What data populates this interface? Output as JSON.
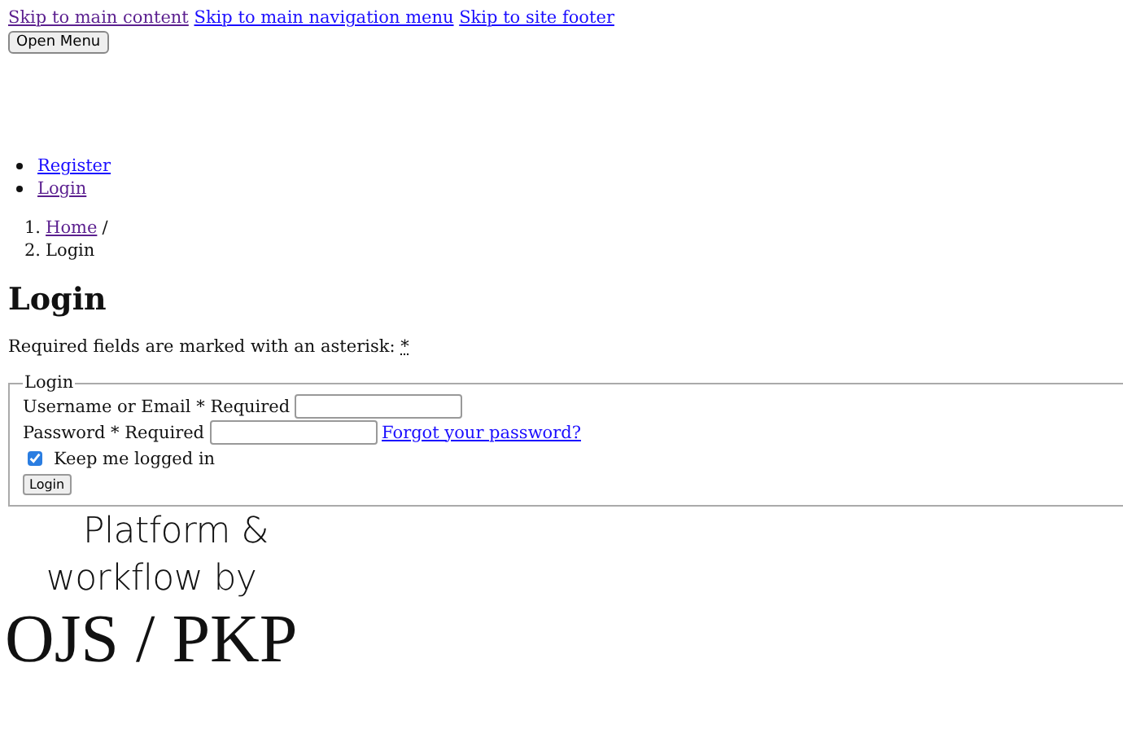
{
  "skip_links": [
    {
      "label": "Skip to main content",
      "visited": true
    },
    {
      "label": "Skip to main navigation menu",
      "visited": false
    },
    {
      "label": "Skip to site footer",
      "visited": false
    }
  ],
  "menu_button": "Open Menu",
  "user_nav": [
    {
      "label": "Register",
      "visited": false
    },
    {
      "label": "Login",
      "visited": true
    }
  ],
  "breadcrumb": [
    {
      "marker": "1.",
      "label": "Home",
      "separator": "/",
      "kind": "link"
    },
    {
      "marker": "2.",
      "label": "Login",
      "kind": "current"
    }
  ],
  "heading": "Login",
  "required_note": "Required fields are marked with an asterisk: ",
  "required_mark": "*",
  "form": {
    "legend": "Login",
    "username_label": "Username or Email * Required",
    "password_label": "Password * Required",
    "forgot_link": "Forgot your password?",
    "remember": {
      "label": "Keep me logged in",
      "checked": true
    },
    "submit": "Login"
  },
  "footer": {
    "lines": [
      "Platform &",
      "workflow by"
    ],
    "logo": "OJS / PKP"
  }
}
